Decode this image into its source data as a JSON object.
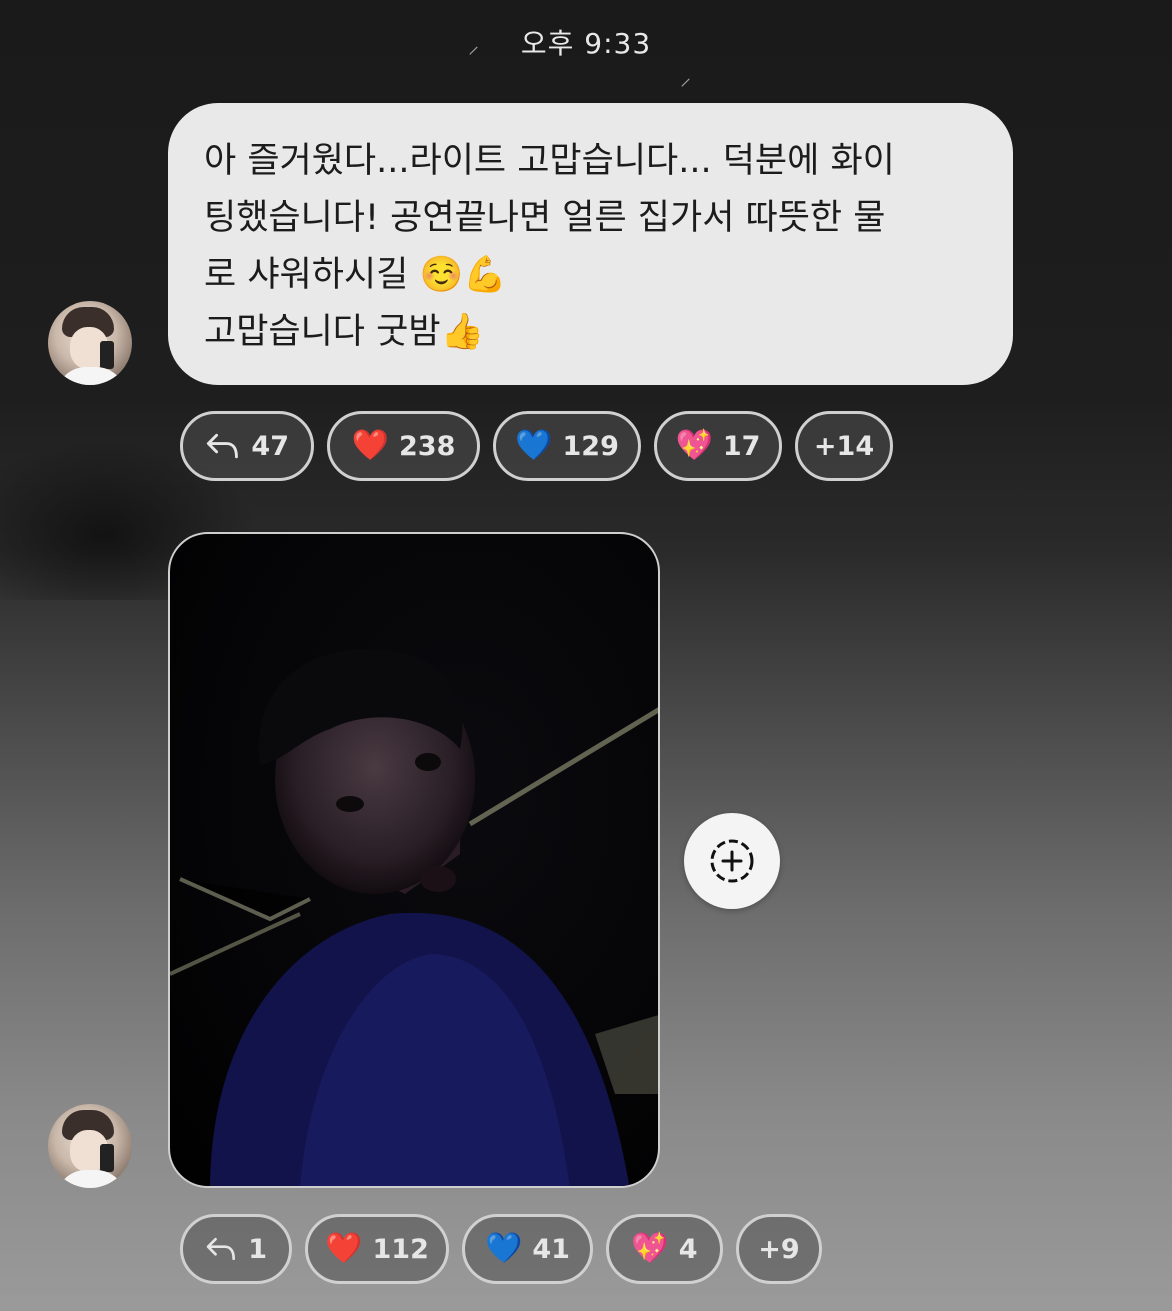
{
  "timestamp": "오후 9:33",
  "message": {
    "lines": [
      "아 즐거웠다...라이트 고맙습니다... 덕분에 화이",
      "팅했습니다! 공연끝나면 얼른 집가서 따뜻한 물",
      "로 샤워하시길 ☺️💪",
      "고맙습니다 굿밤👍"
    ]
  },
  "reactions_1": {
    "reply_count": "47",
    "items": [
      {
        "emoji": "❤️",
        "count": "238"
      },
      {
        "emoji": "💙",
        "count": "129"
      },
      {
        "emoji": "💖",
        "count": "17"
      }
    ],
    "more": "+14"
  },
  "reactions_2": {
    "reply_count": "1",
    "items": [
      {
        "emoji": "❤️",
        "count": "112"
      },
      {
        "emoji": "💙",
        "count": "41"
      },
      {
        "emoji": "💖",
        "count": "4"
      }
    ],
    "more": "+9"
  },
  "icons": {
    "reply": "reply-arrow-icon",
    "share": "add-to-story-icon"
  },
  "colors": {
    "bubble": "#e9e9e9",
    "chip_border": "#d0d0d0",
    "text": "#1c1c1c"
  }
}
